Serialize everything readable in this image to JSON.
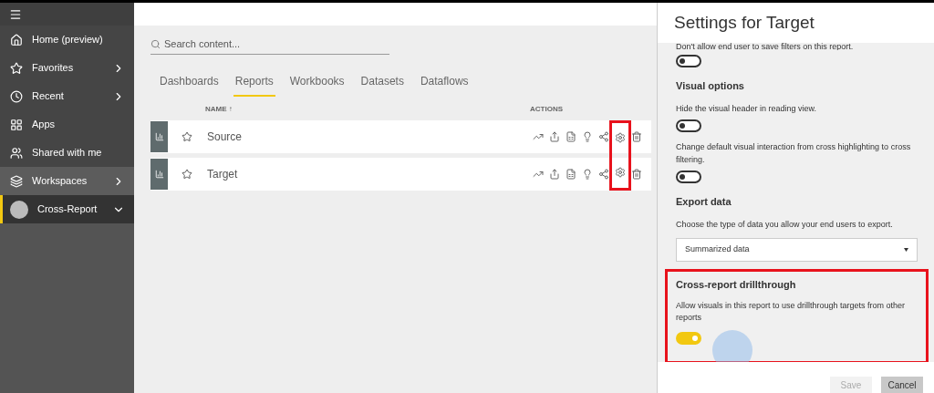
{
  "sidebar": {
    "items": [
      {
        "label": "Home (preview)",
        "selected": false
      },
      {
        "label": "Favorites",
        "selected": false
      },
      {
        "label": "Recent",
        "selected": false
      },
      {
        "label": "Apps",
        "selected": false
      },
      {
        "label": "Shared with me",
        "selected": false
      },
      {
        "label": "Workspaces",
        "selected": false
      },
      {
        "label": "Cross-Report",
        "selected": true
      }
    ]
  },
  "search": {
    "placeholder": "Search content..."
  },
  "tabs": [
    {
      "label": "Dashboards",
      "selected": false
    },
    {
      "label": "Reports",
      "selected": true
    },
    {
      "label": "Workbooks",
      "selected": false
    },
    {
      "label": "Datasets",
      "selected": false
    },
    {
      "label": "Dataflows",
      "selected": false
    }
  ],
  "table": {
    "columns": [
      "NAME ↑",
      "ACTIONS"
    ],
    "rows": [
      {
        "name": "Source"
      },
      {
        "name": "Target"
      }
    ]
  },
  "panel": {
    "title": "Settings for Target",
    "sections": [
      {
        "kind": "toggle",
        "text": "Don't allow end user to save filters on this report.",
        "on": false
      },
      {
        "kind": "heading",
        "text": "Visual options"
      },
      {
        "kind": "toggle",
        "text": "Hide the visual header in reading view.",
        "on": false
      },
      {
        "kind": "toggle",
        "text": "Change default visual interaction from cross highlighting to cross filtering.",
        "on": false
      },
      {
        "kind": "heading",
        "text": "Export data"
      },
      {
        "kind": "select",
        "text": "Choose the type of data you allow your end users to export.",
        "value": "Summarized data"
      },
      {
        "kind": "highlight",
        "heading": "Cross-report drillthrough",
        "text": "Allow visuals in this report to use drillthrough targets from other reports",
        "on": true
      }
    ],
    "buttons": [
      {
        "label": "Save",
        "disabled": true
      },
      {
        "label": "Cancel",
        "disabled": false
      }
    ]
  }
}
